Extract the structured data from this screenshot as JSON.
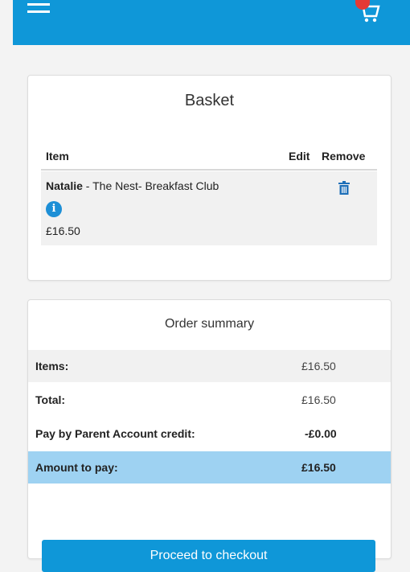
{
  "header": {
    "menu_icon": "hamburger-menu-icon",
    "cart_icon": "shopping-cart-icon",
    "brand_color": "#0f97d8",
    "badge_color": "#e53935"
  },
  "basket": {
    "title": "Basket",
    "columns": {
      "item": "Item",
      "edit": "Edit",
      "remove": "Remove"
    },
    "items": [
      {
        "child": "Natalie",
        "description": " - The Nest- Breakfast Club",
        "price": "£16.50",
        "info_icon": "info-icon",
        "remove_icon": "trash-icon"
      }
    ]
  },
  "summary": {
    "title": "Order summary",
    "rows": [
      {
        "label": "Items:",
        "value": "£16.50"
      },
      {
        "label": "Total:",
        "value": "£16.50"
      },
      {
        "label": "Pay by Parent Account credit:",
        "value": "-£0.00"
      },
      {
        "label": "Amount to pay:",
        "value": "£16.50"
      }
    ],
    "highlight_color": "#9ed2f2"
  },
  "checkout": {
    "label": "Proceed to checkout"
  }
}
